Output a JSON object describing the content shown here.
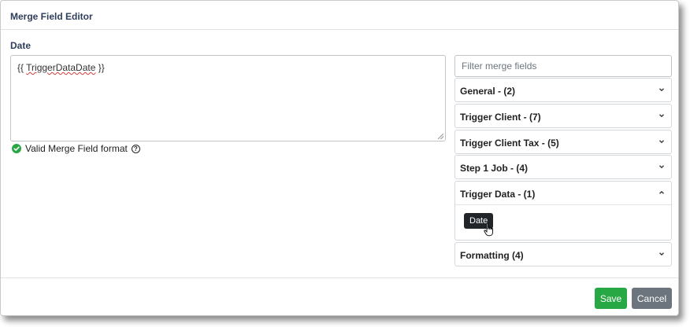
{
  "dialog": {
    "title": "Merge Field Editor",
    "field_label": "Date",
    "editor_value_prefix": "{{ ",
    "editor_value_token": "TriggerDataDate",
    "editor_value_suffix": " }}",
    "valid_text": "Valid Merge Field format",
    "help_glyph": "?"
  },
  "filter": {
    "placeholder": "Filter merge fields"
  },
  "accordion": {
    "general": "General - (2)",
    "trigger_client": "Trigger Client - (7)",
    "trigger_client_tax": "Trigger Client Tax - (5)",
    "step1_job": "Step 1 Job - (4)",
    "trigger_data": "Trigger Data - (1)",
    "trigger_data_items": [
      "Date"
    ],
    "formatting": "Formatting (4)"
  },
  "footer": {
    "save_label": "Save",
    "cancel_label": "Cancel"
  },
  "colors": {
    "success": "#28a745",
    "secondary": "#6c757d",
    "title": "#2f3e5b"
  }
}
